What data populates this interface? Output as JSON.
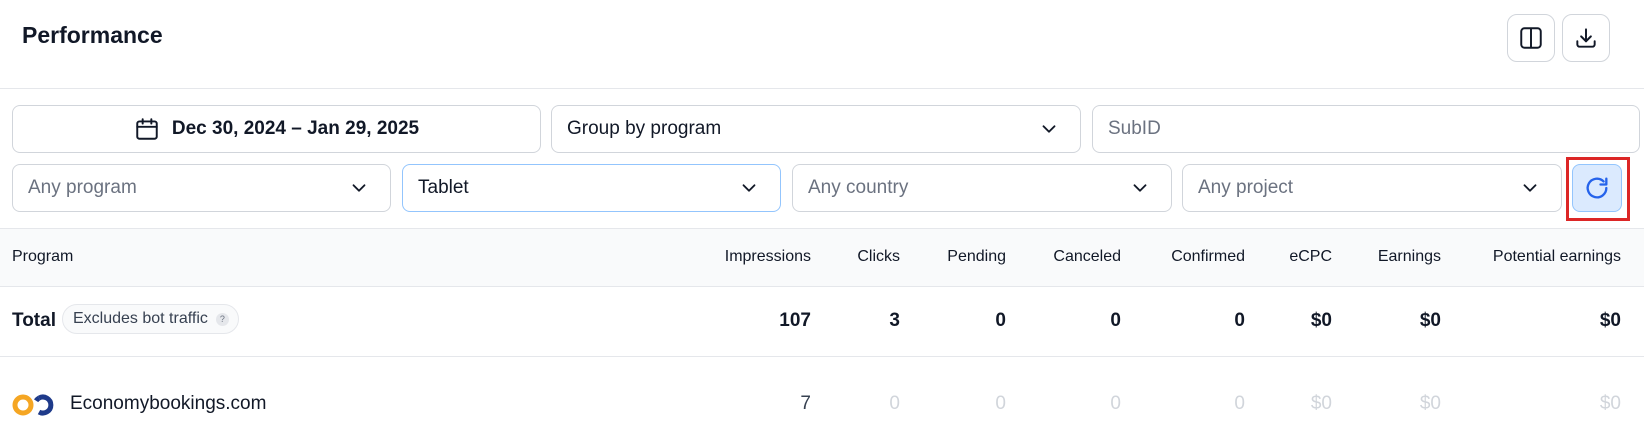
{
  "header": {
    "title": "Performance",
    "columns_toggle_icon": "columns-icon",
    "download_icon": "download-icon"
  },
  "filters": {
    "date_range": "Dec 30, 2024 – Jan 29, 2025",
    "group_by": "Group by program",
    "subid_placeholder": "SubID",
    "program_placeholder": "Any program",
    "device_value": "Tablet",
    "country_placeholder": "Any country",
    "project_placeholder": "Any project",
    "refresh_icon": "refresh-icon"
  },
  "table": {
    "columns": [
      "Program",
      "Impressions",
      "Clicks",
      "Pending",
      "Canceled",
      "Confirmed",
      "eCPC",
      "Earnings",
      "Potential earnings"
    ],
    "total": {
      "label": "Total",
      "badge": "Excludes bot traffic",
      "badge_help": "?",
      "impressions": "107",
      "clicks": "3",
      "pending": "0",
      "canceled": "0",
      "confirmed": "0",
      "ecpc": "$0",
      "earnings": "$0",
      "potential_earnings": "$0"
    },
    "rows": [
      {
        "program": "Economybookings.com",
        "logo_icon": "economybookings-logo",
        "impressions": "7",
        "clicks": "0",
        "pending": "0",
        "canceled": "0",
        "confirmed": "0",
        "ecpc": "$0",
        "earnings": "$0",
        "potential_earnings": "$0"
      }
    ]
  },
  "colors": {
    "accent": "#2563eb",
    "highlight": "#dc2626",
    "logo_orange": "#f5a623",
    "logo_blue": "#1e3a8a"
  }
}
